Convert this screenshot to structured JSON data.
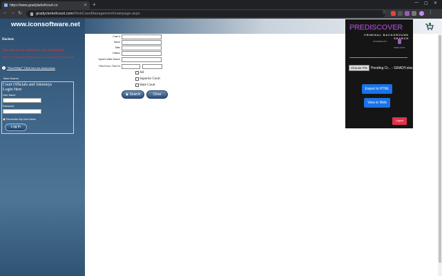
{
  "browser": {
    "tab_title": "https://www.gradylarkofcourt.co",
    "url_host": "gradyclerkofcourt.com",
    "url_path": "/WebCaseManagement/mainpage.aspx"
  },
  "site": {
    "banner_title": "www.iconsoftware.net",
    "dockets_label": "Dockets",
    "alert_line1": "Welcome to our website for case information",
    "alert_line2": "Notice for Attorneys: Please create your account here to continue",
    "help_link": "\"Need Help?\" Click here for instructions",
    "new_search": "New Search",
    "login": {
      "title_line1": "Court Officials and Attorneys",
      "title_line2": "Login Here",
      "user_label": "User Name:",
      "password_label": "Password:",
      "remember_label": "Remember My User Name",
      "login_button": "Log In"
    }
  },
  "form": {
    "fields": [
      {
        "label": "Case #"
      },
      {
        "label": "Name"
      },
      {
        "label": "Alias"
      },
      {
        "label": "Citation"
      },
      {
        "label": "System Wide Search"
      },
      {
        "label": "Filed From / Filed To"
      }
    ],
    "courts": [
      "All",
      "Superior Court",
      "State Court"
    ],
    "search_button": "Search",
    "clear_button": "Clear"
  },
  "extension": {
    "logo": "PREDISCOVER",
    "subtitle": "CRIMINAL BACKGROUND SEARCH",
    "powered_by": "POWERED BY",
    "brand": "VERILANTE",
    "choose_file": "Choose File",
    "file_name": "Pending Cr... - GRADY.xlsx",
    "export_button": "Export to HTML",
    "view_button": "View in Web",
    "logout_button": "Logout"
  }
}
